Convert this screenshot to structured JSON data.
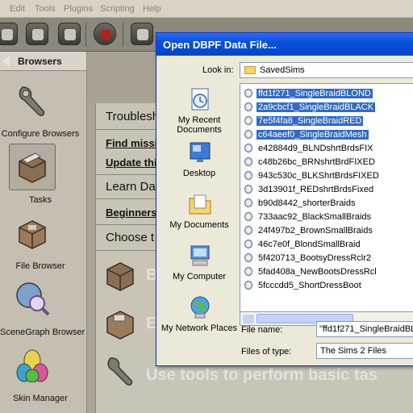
{
  "menu": {
    "items": [
      "Edit",
      "Tools",
      "Plugins",
      "Scripting",
      "Help"
    ]
  },
  "sidebar": {
    "title": "Browsers",
    "items": [
      {
        "label": "Configure Browsers",
        "icon": "wrench-icon"
      },
      {
        "label": "Tasks",
        "icon": "tasks-box-icon"
      },
      {
        "label": "File Browser",
        "icon": "file-box-icon"
      },
      {
        "label": "SceneGraph Browser",
        "icon": "scenegraph-icon"
      },
      {
        "label": "Skin Manager",
        "icon": "skin-eggs-icon"
      }
    ]
  },
  "main": {
    "section1_title": "Troublesh",
    "link1": "Find missin",
    "link2": "Update thi",
    "section2_title": "Learn Da",
    "link3": "Beginners",
    "section3_title": "Choose t",
    "task_b": "B",
    "task_e": "E",
    "task_tools": "Use tools to perform basic tas"
  },
  "dialog": {
    "title": "Open DBPF Data File...",
    "look_in_label": "Look in:",
    "look_in_value": "SavedSims",
    "places": [
      "My Recent Documents",
      "Desktop",
      "My Documents",
      "My Computer",
      "My Network Places"
    ],
    "files": [
      {
        "name": "ffd1f271_SingleBraidBLOND",
        "selected": true
      },
      {
        "name": "2a9cbcf1_SingleBraidBLACK",
        "selected": true
      },
      {
        "name": "7e5f4fa8_SingleBraidRED",
        "selected": true
      },
      {
        "name": "c64aeef0_SingleBraidMesh",
        "selected": true
      },
      {
        "name": "e42884d9_BLNDshrtBrdsFIX",
        "selected": false
      },
      {
        "name": "c48b26bc_BRNshrtBrdFIXED",
        "selected": false
      },
      {
        "name": "943c530c_BLKShrtBrdsFIXED",
        "selected": false
      },
      {
        "name": "3d13901f_REDshrtBrdsFixed",
        "selected": false
      },
      {
        "name": "b90d8442_shorterBraids",
        "selected": false
      },
      {
        "name": "733aac92_BlackSmallBraids",
        "selected": false
      },
      {
        "name": "24f497b2_BrownSmallBraids",
        "selected": false
      },
      {
        "name": "46c7e0f_BlondSmallBraid",
        "selected": false
      },
      {
        "name": "5f420713_BootsyDressRclr2",
        "selected": false
      },
      {
        "name": "5fad408a_NewBootsDressRcl",
        "selected": false
      },
      {
        "name": "5fcccdd5_ShortDressBoot",
        "selected": false
      }
    ],
    "file_name_label": "File name:",
    "file_name_value": "\"ffd1f271_SingleBraidBL",
    "file_type_label": "Files of type:",
    "file_type_value": "The Sims 2 Files"
  }
}
